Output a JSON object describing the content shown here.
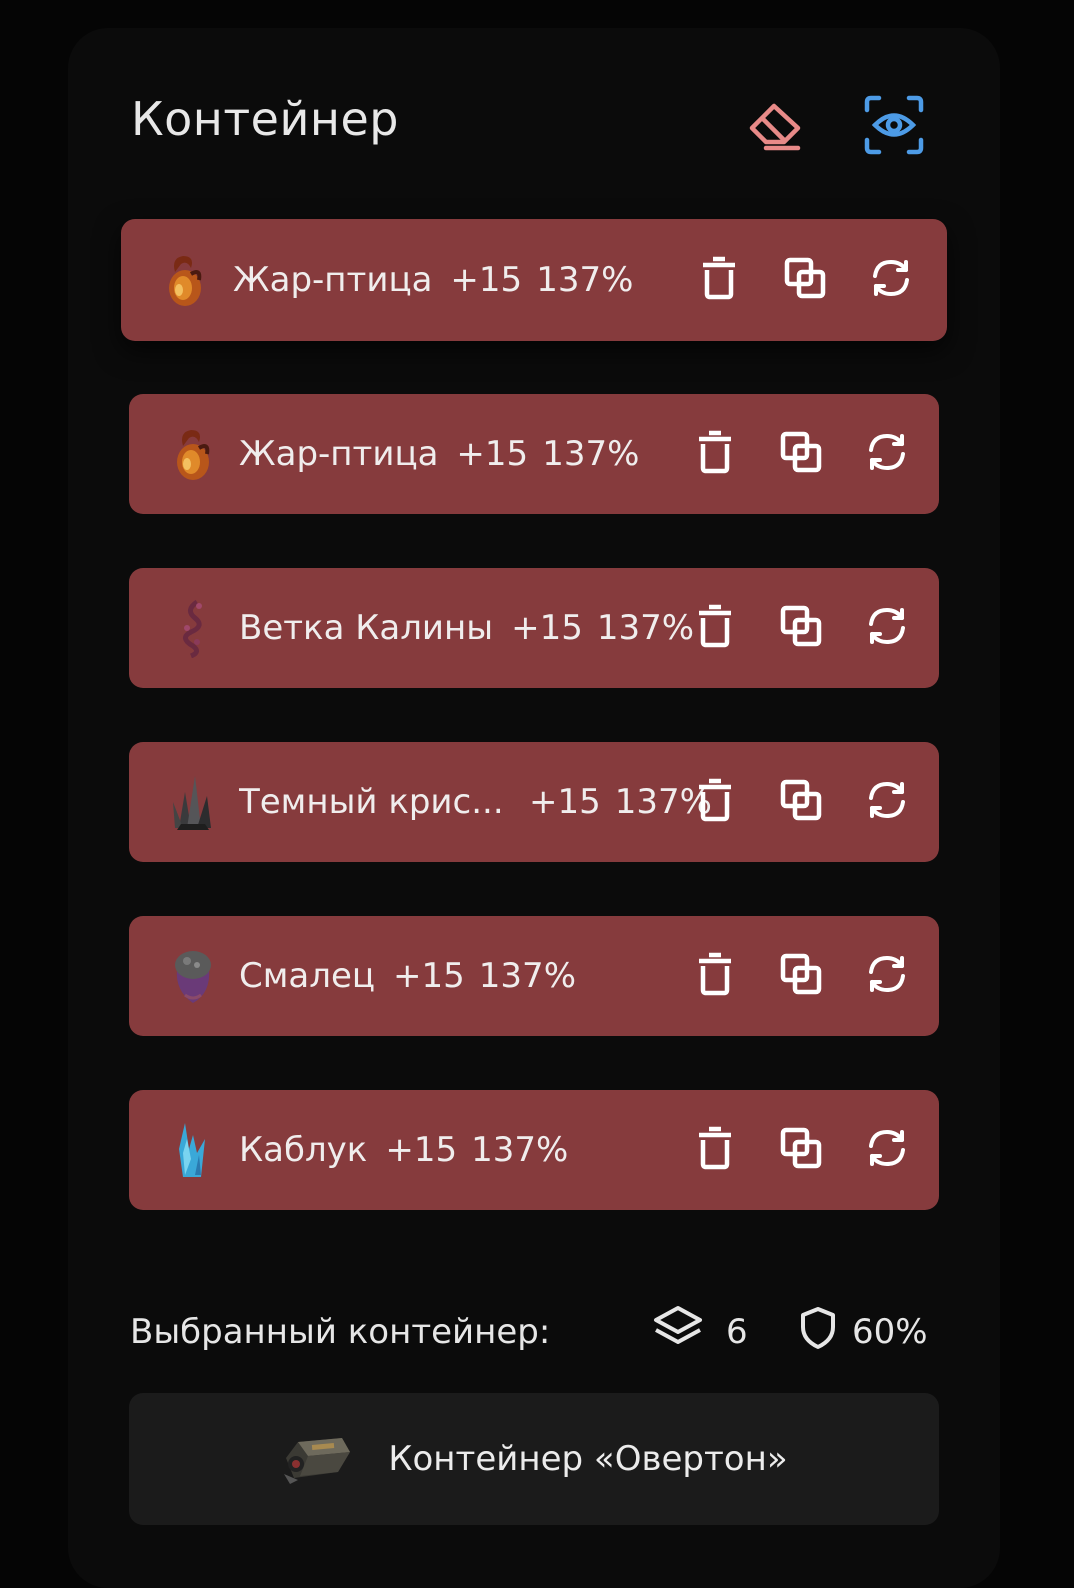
{
  "header": {
    "title": "Контейнер",
    "clear_icon": "eraser-icon",
    "preview_icon": "eye-scan-icon"
  },
  "artifacts": [
    {
      "name": "Жар-птица",
      "level": "+15",
      "percent": "137%",
      "icon": "firebird-artifact-icon"
    },
    {
      "name": "Жар-птица",
      "level": "+15",
      "percent": "137%",
      "icon": "firebird-artifact-icon"
    },
    {
      "name": "Ветка Калины",
      "level": "+15",
      "percent": "137%",
      "icon": "viburnum-branch-artifact-icon"
    },
    {
      "name": "Темный крис...",
      "level": "+15",
      "percent": "137%",
      "icon": "dark-crystal-artifact-icon"
    },
    {
      "name": "Смалец",
      "level": "+15",
      "percent": "137%",
      "icon": "lard-artifact-icon"
    },
    {
      "name": "Каблук",
      "level": "+15",
      "percent": "137%",
      "icon": "heel-artifact-icon"
    }
  ],
  "row_actions": [
    "trash-icon",
    "copy-icon",
    "refresh-icon"
  ],
  "summary": {
    "label": "Выбранный контейнер:",
    "slots_icon": "layers-icon",
    "slots": "6",
    "protection_icon": "shield-icon",
    "protection": "60%"
  },
  "container": {
    "name": "Контейнер «Овертон»",
    "icon": "container-item-icon"
  },
  "colors": {
    "row_bg": "#863b3d",
    "eraser": "#e88a88",
    "eye": "#4d9be6",
    "panel": "#0b0b0b"
  }
}
